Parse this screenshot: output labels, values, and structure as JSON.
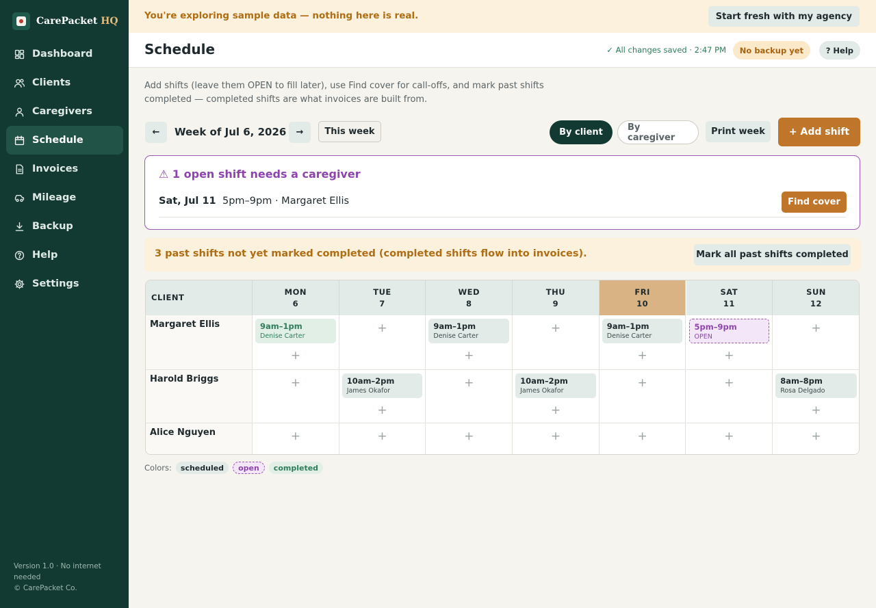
{
  "brand": {
    "name": "CarePacket",
    "suffix": "HQ"
  },
  "nav": [
    {
      "label": "Dashboard",
      "icon": "dashboard-icon"
    },
    {
      "label": "Clients",
      "icon": "clients-icon"
    },
    {
      "label": "Caregivers",
      "icon": "caregivers-icon"
    },
    {
      "label": "Schedule",
      "icon": "calendar-icon",
      "active": true
    },
    {
      "label": "Invoices",
      "icon": "invoice-icon"
    },
    {
      "label": "Mileage",
      "icon": "car-icon"
    },
    {
      "label": "Backup",
      "icon": "download-icon"
    },
    {
      "label": "Help",
      "icon": "help-icon"
    },
    {
      "label": "Settings",
      "icon": "gear-icon"
    }
  ],
  "footer": {
    "line1": "Version 1.0 · No internet",
    "line2": "needed",
    "line3": "© CarePacket Co."
  },
  "banner": {
    "text": "You're exploring sample data — nothing here is real.",
    "button": "Start fresh with my agency"
  },
  "header": {
    "title": "Schedule",
    "saved": "✓ All changes saved · 2:47 PM",
    "backup": "No backup yet",
    "help": "? Help"
  },
  "intro": "Add shifts (leave them OPEN to fill later), use Find cover for call-offs, and mark past shifts completed — completed shifts are what invoices are built from.",
  "toolbar": {
    "prev": "←",
    "week_label": "Week of Jul 6, 2026",
    "next": "→",
    "this_week": "This week",
    "by_client": "By client",
    "by_caregiver": "By caregiver",
    "print": "Print week",
    "add_shift": "+ Add shift"
  },
  "open_panel": {
    "title": "⚠ 1 open shift needs a caregiver",
    "date": "Sat, Jul 11",
    "desc": "5pm–9pm · Margaret Ellis",
    "button": "Find cover"
  },
  "past_notice": {
    "text": "3 past shifts not yet marked completed (completed shifts flow into invoices).",
    "button": "Mark all past shifts completed"
  },
  "grid": {
    "client_header": "CLIENT",
    "days": [
      {
        "name": "MON",
        "num": "6"
      },
      {
        "name": "TUE",
        "num": "7"
      },
      {
        "name": "WED",
        "num": "8"
      },
      {
        "name": "THU",
        "num": "9"
      },
      {
        "name": "FRI",
        "num": "10",
        "today": true
      },
      {
        "name": "SAT",
        "num": "11"
      },
      {
        "name": "SUN",
        "num": "12"
      }
    ],
    "plus": "+",
    "rows": [
      {
        "client": "Margaret Ellis",
        "shifts": [
          {
            "day": 0,
            "time": "9am–1pm",
            "person": "Denise Carter",
            "status": "completed"
          },
          {
            "day": 2,
            "time": "9am–1pm",
            "person": "Denise Carter",
            "status": "scheduled"
          },
          {
            "day": 4,
            "time": "9am–1pm",
            "person": "Denise Carter",
            "status": "scheduled"
          },
          {
            "day": 5,
            "time": "5pm–9pm",
            "person": "OPEN",
            "status": "open"
          }
        ]
      },
      {
        "client": "Harold Briggs",
        "shifts": [
          {
            "day": 1,
            "time": "10am–2pm",
            "person": "James Okafor",
            "status": "scheduled"
          },
          {
            "day": 3,
            "time": "10am–2pm",
            "person": "James Okafor",
            "status": "scheduled"
          },
          {
            "day": 6,
            "time": "8am–8pm",
            "person": "Rosa Delgado",
            "status": "scheduled"
          }
        ]
      },
      {
        "client": "Alice Nguyen",
        "shifts": []
      }
    ]
  },
  "legend": {
    "label": "Colors:",
    "scheduled": "scheduled",
    "open": "open",
    "completed": "completed"
  }
}
